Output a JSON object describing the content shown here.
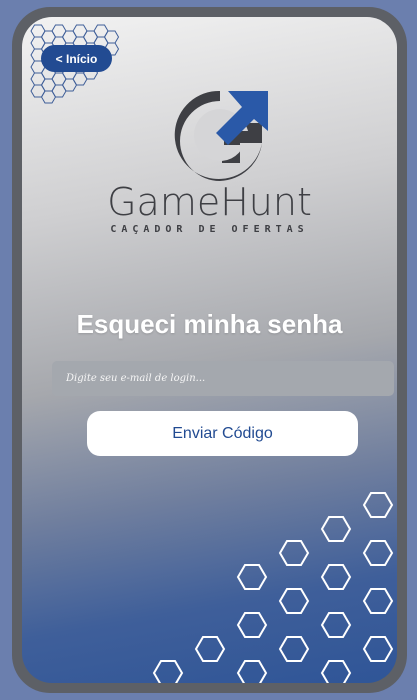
{
  "nav": {
    "back_label": "< Início"
  },
  "brand": {
    "name": "GameHunt",
    "tagline": "CAÇADOR DE OFERTAS",
    "icon": "gamehunt-logo-icon"
  },
  "form": {
    "title": "Esqueci minha senha",
    "email_placeholder": "Digite seu e-mail de login...",
    "email_value": "",
    "submit_label": "Enviar Código"
  },
  "colors": {
    "background": "#6b7fae",
    "frame": "#5d6066",
    "accent": "#224b92",
    "logo_gray": "#3e3f44",
    "logo_blue": "#2a59a8"
  }
}
